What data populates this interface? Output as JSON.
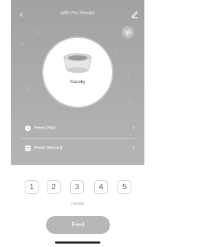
{
  "header": {
    "title": "WiFi Pet Feeder",
    "back_icon": "chevron-left-icon",
    "edit_icon": "pencil-icon",
    "settings_icon": "gear-icon"
  },
  "device": {
    "status": "Standby",
    "image_icon": "pet-bowl-icon"
  },
  "menu": [
    {
      "label": "Feed Plan",
      "icon": "clock-icon"
    },
    {
      "label": "Feed Record",
      "icon": "list-icon"
    }
  ],
  "portion": {
    "options": [
      "1",
      "2",
      "3",
      "4",
      "5"
    ],
    "label": "Portion"
  },
  "feed_button": {
    "label": "Feed"
  },
  "colors": {
    "hero_background": "#a9a9a9",
    "feed_button": "#b7b7b7",
    "portion_border": "#cfcfcf"
  }
}
